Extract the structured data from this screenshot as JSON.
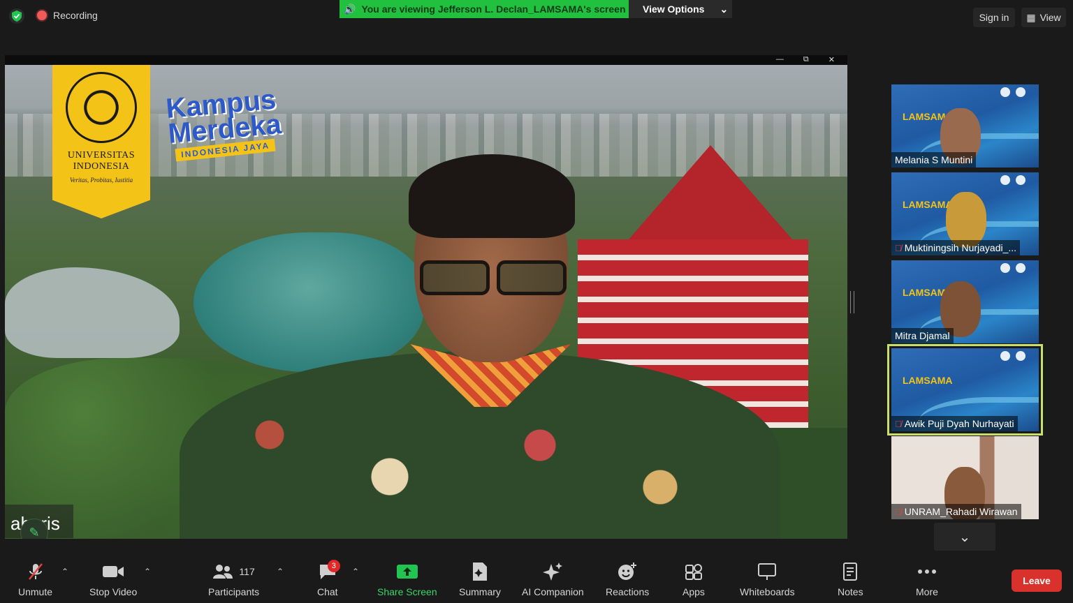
{
  "topbar": {
    "recording_label": "Recording",
    "banner_text": "You are viewing Jefferson L. Declan_LAMSAMA's screen",
    "view_options_label": "View Options",
    "sign_in_label": "Sign in",
    "view_label": "View"
  },
  "main_video": {
    "logo_name_1": "UNIVERSITAS",
    "logo_name_2": "INDONESIA",
    "logo_motto": "Veritas, Probitas, Iustitia",
    "brand_line_1": "Kampus",
    "brand_line_2": "Merdeka",
    "brand_sub": "INDONESIA JAYA",
    "speaker_name": "aharis"
  },
  "participants_panel": {
    "slide_title": "LAMSAMA",
    "tiles": [
      {
        "name": "Melania S Muntini",
        "muted": false
      },
      {
        "name": "Muktiningsih Nurjayadi_...",
        "muted": true
      },
      {
        "name": "Mitra Djamal",
        "muted": false
      },
      {
        "name": "Awik Puji Dyah Nurhayati",
        "muted": true,
        "active": true
      },
      {
        "name": "UNRAM_Rahadi Wirawan",
        "muted": true
      }
    ]
  },
  "toolbar": {
    "unmute": "Unmute",
    "stop_video": "Stop Video",
    "participants": "Participants",
    "participants_count": "117",
    "chat": "Chat",
    "chat_badge": "3",
    "share_screen": "Share Screen",
    "summary": "Summary",
    "ai_companion": "AI Companion",
    "reactions": "Reactions",
    "apps": "Apps",
    "whiteboards": "Whiteboards",
    "notes": "Notes",
    "more": "More",
    "leave": "Leave"
  },
  "colors": {
    "banner_green": "#21c13f",
    "share_green": "#3bd56b",
    "leave_red": "#d9312b",
    "active_tile_outline": "#c8e06b"
  }
}
